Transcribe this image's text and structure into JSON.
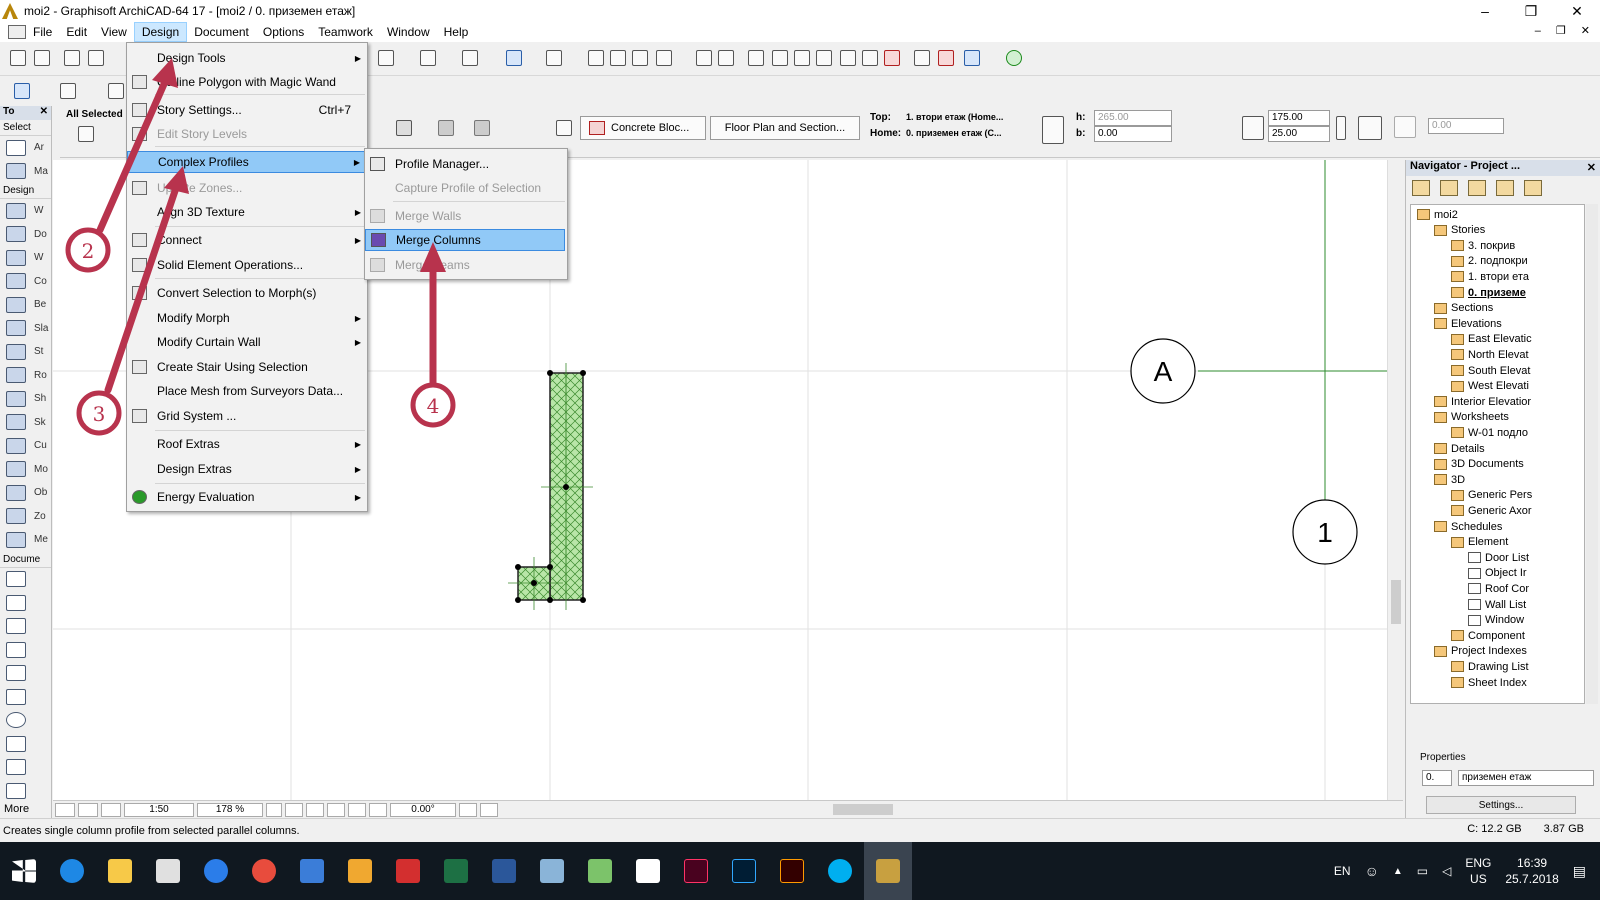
{
  "window": {
    "title": "moi2 - Graphisoft ArchiCAD-64 17 - [moi2 / 0. приземен етаж]",
    "minimize": "–",
    "restore": "❐",
    "close": "✕"
  },
  "menubar": [
    "File",
    "Edit",
    "View",
    "Design",
    "Document",
    "Options",
    "Teamwork",
    "Window",
    "Help"
  ],
  "menubar_doc_controls": "– ❐ ✕",
  "infobox": {
    "all_selected": "All Selected",
    "composite": "Concrete Bloc...",
    "view_mode": "Floor Plan and Section...",
    "top_label": "Top:",
    "top_value": "1. втори етаж (Home...",
    "home_label": "Home:",
    "home_value": "0. приземен етаж (C...",
    "h_label": "h:",
    "h_value": "265.00",
    "b_label": "b:",
    "b_value": "0.00",
    "dim1": "175.00",
    "dim2": "25.00",
    "angle_value": "0.00"
  },
  "toolbox": {
    "header": "To",
    "select_label": "Select",
    "design_label": "Design",
    "document_label": "Docume",
    "more_label": "More",
    "tools": [
      {
        "name": "arrow",
        "label": "Ar"
      },
      {
        "name": "marquee",
        "label": "Ma"
      }
    ],
    "design_tools": [
      "W",
      "Do",
      "W",
      "Co",
      "Be",
      "Sla",
      "St",
      "Ro",
      "Sh",
      "Sk",
      "Cu",
      "Mo",
      "Ob",
      "Zo",
      "Me"
    ],
    "document_tools": [
      "",
      "",
      "",
      "",
      "",
      "",
      "",
      "",
      "",
      ""
    ]
  },
  "design_menu": {
    "items": [
      {
        "label": "Design Tools",
        "submenu": true,
        "disabled": false
      },
      {
        "label": "Outline Polygon with Magic Wand",
        "submenu": false,
        "disabled": false
      },
      {
        "label": "Story Settings...",
        "shortcut": "Ctrl+7",
        "disabled": false
      },
      {
        "label": "Edit Story Levels",
        "disabled": true
      },
      {
        "label": "Complex Profiles",
        "submenu": true,
        "highlighted": true
      },
      {
        "label": "Update Zones...",
        "disabled": true
      },
      {
        "label": "Align 3D Texture",
        "submenu": true
      },
      {
        "label": "Connect",
        "submenu": true
      },
      {
        "label": "Solid Element Operations..."
      },
      {
        "label": "Convert Selection to Morph(s)"
      },
      {
        "label": "Modify Morph",
        "submenu": true
      },
      {
        "label": "Modify Curtain Wall",
        "submenu": true
      },
      {
        "label": "Create Stair Using Selection"
      },
      {
        "label": "Place Mesh from Surveyors Data..."
      },
      {
        "label": "Grid System ..."
      },
      {
        "label": "Roof Extras",
        "submenu": true
      },
      {
        "label": "Design Extras",
        "submenu": true
      },
      {
        "label": "Energy Evaluation",
        "submenu": true
      }
    ]
  },
  "profiles_submenu": {
    "items": [
      {
        "label": "Profile Manager...",
        "disabled": false
      },
      {
        "label": "Capture Profile of Selection",
        "disabled": true
      },
      {
        "label": "Merge Walls",
        "disabled": true
      },
      {
        "label": "Merge Columns",
        "highlighted": true
      },
      {
        "label": "Merge Beams",
        "disabled": true
      }
    ]
  },
  "canvas": {
    "grid_label_a": "A",
    "grid_label_1": "1"
  },
  "annotations": [
    "2",
    "3",
    "4"
  ],
  "bottombar": {
    "scale": "1:50",
    "zoom": "178 %",
    "angle": "0.00°"
  },
  "statusbar": {
    "message": "Creates single column profile from selected parallel columns.",
    "disk": "C: 12.2 GB",
    "memory": "3.87 GB"
  },
  "navigator": {
    "header": "Navigator - Project ...",
    "tree": [
      {
        "label": "moi2",
        "level": 0
      },
      {
        "label": "Stories",
        "level": 1
      },
      {
        "label": "3. покрив",
        "level": 2
      },
      {
        "label": "2. подпокри",
        "level": 2
      },
      {
        "label": "1. втори ета",
        "level": 2
      },
      {
        "label": "0. приземе",
        "level": 2,
        "selected": true
      },
      {
        "label": "Sections",
        "level": 1
      },
      {
        "label": "Elevations",
        "level": 1
      },
      {
        "label": "East Elevatic",
        "level": 2
      },
      {
        "label": "North Elevat",
        "level": 2
      },
      {
        "label": "South Elevat",
        "level": 2
      },
      {
        "label": "West Elevati",
        "level": 2
      },
      {
        "label": "Interior Elevatior",
        "level": 1
      },
      {
        "label": "Worksheets",
        "level": 1
      },
      {
        "label": "W-01 подло",
        "level": 2
      },
      {
        "label": "Details",
        "level": 1
      },
      {
        "label": "3D Documents",
        "level": 1
      },
      {
        "label": "3D",
        "level": 1
      },
      {
        "label": "Generic Pers",
        "level": 2
      },
      {
        "label": "Generic Axor",
        "level": 2
      },
      {
        "label": "Schedules",
        "level": 1
      },
      {
        "label": "Element",
        "level": 2
      },
      {
        "label": "Door List",
        "level": 3
      },
      {
        "label": "Object Ir",
        "level": 3
      },
      {
        "label": "Roof Cor",
        "level": 3
      },
      {
        "label": "Wall List",
        "level": 3
      },
      {
        "label": "Window",
        "level": 3
      },
      {
        "label": "Component",
        "level": 2
      },
      {
        "label": "Project Indexes",
        "level": 1
      },
      {
        "label": "Drawing List",
        "level": 2
      },
      {
        "label": "Sheet Index",
        "level": 2
      }
    ],
    "properties_label": "Properties",
    "prop_id": "0.",
    "prop_name": "приземен етаж",
    "settings_button": "Settings..."
  },
  "taskbar": {
    "lang": "ENG",
    "lang_region": "US",
    "time": "16:39",
    "date": "25.7.2018",
    "en": "EN"
  }
}
